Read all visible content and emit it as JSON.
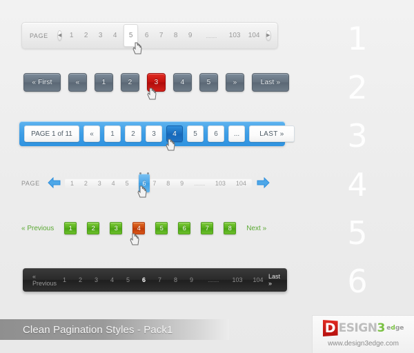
{
  "steps": [
    "1",
    "2",
    "3",
    "4",
    "5",
    "6"
  ],
  "style1": {
    "label": "PAGE",
    "prev_icon": "circle-left-arrow-icon",
    "next_icon": "circle-right-arrow-icon",
    "pages": [
      "1",
      "2",
      "3",
      "4"
    ],
    "current": "5",
    "pages_after": [
      "6",
      "7",
      "8",
      "9"
    ],
    "ellipsis": "........",
    "pages_tail": [
      "103",
      "104"
    ]
  },
  "style2": {
    "first": "« First",
    "prev": "«",
    "pages": [
      "1",
      "2"
    ],
    "current": "3",
    "pages_after": [
      "4",
      "5"
    ],
    "next": "»",
    "last": "Last »",
    "accent": "#c2120f"
  },
  "style3": {
    "info": "PAGE 1 of 11",
    "prev": "«",
    "pages": [
      "1",
      "2",
      "3"
    ],
    "current": "4",
    "pages_after": [
      "5",
      "6"
    ],
    "ellipsis": "...",
    "last": "LAST »",
    "accent": "#1668b9"
  },
  "style4": {
    "label": "PAGE",
    "prev_icon": "left-arrow-icon",
    "next_icon": "right-arrow-icon",
    "pages": [
      "1",
      "2",
      "3",
      "4",
      "5"
    ],
    "current": "6",
    "pages_after": [
      "7",
      "8",
      "9"
    ],
    "ellipsis": "........",
    "pages_tail": [
      "103",
      "104"
    ],
    "accent": "#4ea7e8"
  },
  "style5": {
    "previous": "« Previous",
    "pages": [
      "1",
      "2",
      "3"
    ],
    "current": "4",
    "pages_after": [
      "5",
      "6",
      "7",
      "8"
    ],
    "next": "Next »",
    "accent": "#55ad19",
    "active_accent": "#c8440c"
  },
  "style6": {
    "previous": "« Previous",
    "pages": [
      "1",
      "2",
      "3",
      "4",
      "5"
    ],
    "current": "6",
    "pages_after": [
      "7",
      "8",
      "9"
    ],
    "ellipsis": "........",
    "pages_tail": [
      "103",
      "104"
    ],
    "last": "Last »"
  },
  "footer": {
    "title": "Clean Pagination Styles - Pack1",
    "logo_d": "D",
    "logo_esign": "ESIGN",
    "logo_3": "3",
    "logo_edge_e": "e",
    "logo_edge_d": "d",
    "logo_edge_ge": "ge",
    "url": "www.design3edge.com"
  }
}
